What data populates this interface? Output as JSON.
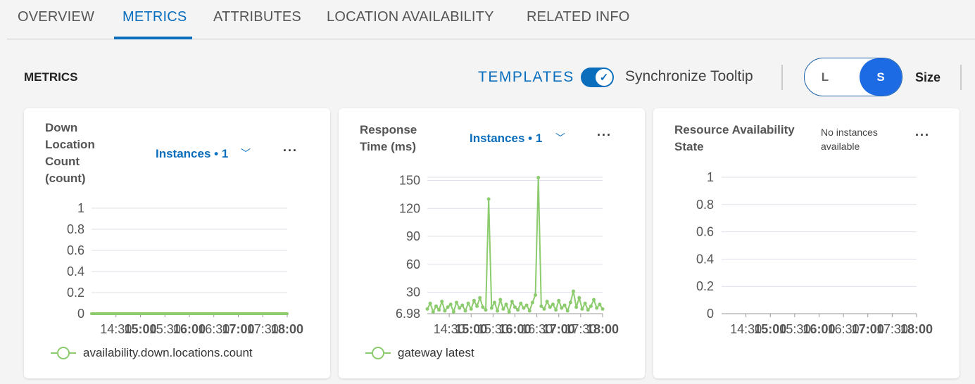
{
  "tabs": [
    {
      "label": "OVERVIEW"
    },
    {
      "label": "METRICS"
    },
    {
      "label": "ATTRIBUTES"
    },
    {
      "label": "LOCATION AVAILABILITY"
    },
    {
      "label": "RELATED INFO"
    }
  ],
  "active_tab": "METRICS",
  "toolbar": {
    "section_title": "METRICS",
    "templates": "TEMPLATES",
    "sync_tooltip": "Synchronize Tooltip",
    "sync_enabled": true,
    "size_options": [
      "L",
      "S"
    ],
    "size_selected": "S",
    "size_label": "Size"
  },
  "colors": {
    "accent": "#0a6ebd",
    "series": "#8ccb6e",
    "size_selected": "#1d6ae5"
  },
  "cards": [
    {
      "title": "Down Location Count (count)",
      "instances": "Instances • 1",
      "legend": "availability.down.locations.count"
    },
    {
      "title": "Response Time (ms)",
      "instances": "Instances • 1",
      "legend": "gateway latest"
    },
    {
      "title": "Resource Availability State",
      "status": "No instances available"
    }
  ],
  "chart_data": [
    {
      "type": "line",
      "ylim": [
        0,
        1
      ],
      "yticks": [
        "0",
        "0.2",
        "0.4",
        "0.6",
        "0.8",
        "1"
      ],
      "yvals": [
        0,
        0.2,
        0.4,
        0.6,
        0.8,
        1
      ],
      "xlim": [
        "14:00",
        "18:00"
      ],
      "xticks": [
        "14:30",
        "15:00",
        "15:30",
        "16:00",
        "16:30",
        "17:00",
        "17:30",
        "18:00"
      ],
      "series": [
        {
          "name": "availability.down.locations.count",
          "x": [
            "14:00",
            "18:00"
          ],
          "values": [
            0,
            0
          ]
        }
      ]
    },
    {
      "type": "line",
      "ylim": [
        6.98,
        153.4
      ],
      "yticks": [
        "6.98",
        "30",
        "60",
        "90",
        "120",
        "150"
      ],
      "yvals": [
        6.98,
        30,
        60,
        90,
        120,
        150
      ],
      "xlim": [
        "14:00",
        "18:00"
      ],
      "xticks": [
        "14:30",
        "15:00",
        "15:30",
        "16:00",
        "16:30",
        "17:00",
        "17:30",
        "18:00"
      ],
      "series": [
        {
          "name": "gateway latest",
          "x": [
            "14:00",
            "14:04",
            "14:08",
            "14:12",
            "14:16",
            "14:20",
            "14:24",
            "14:28",
            "14:32",
            "14:36",
            "14:40",
            "14:44",
            "14:48",
            "14:52",
            "14:56",
            "15:00",
            "15:04",
            "15:08",
            "15:12",
            "15:16",
            "15:20",
            "15:24",
            "15:28",
            "15:32",
            "15:36",
            "15:40",
            "15:44",
            "15:48",
            "15:52",
            "15:56",
            "16:00",
            "16:04",
            "16:08",
            "16:12",
            "16:16",
            "16:20",
            "16:24",
            "16:28",
            "16:32",
            "16:36",
            "16:40",
            "16:44",
            "16:48",
            "16:52",
            "16:56",
            "17:00",
            "17:04",
            "17:08",
            "17:12",
            "17:16",
            "17:20",
            "17:24",
            "17:28",
            "17:32",
            "17:36",
            "17:40",
            "17:44",
            "17:48",
            "17:52",
            "17:56",
            "18:00"
          ],
          "values": [
            12,
            18,
            9,
            15,
            11,
            20,
            10,
            14,
            17,
            9,
            19,
            13,
            16,
            10,
            18,
            12,
            21,
            15,
            24,
            14,
            11,
            130,
            13,
            19,
            10,
            22,
            12,
            17,
            9,
            20,
            14,
            11,
            18,
            13,
            16,
            10,
            19,
            27,
            153,
            15,
            12,
            20,
            14,
            17,
            11,
            21,
            13,
            16,
            10,
            19,
            31,
            14,
            24,
            12,
            18,
            11,
            15,
            22,
            13,
            17,
            12
          ]
        }
      ]
    },
    {
      "type": "line",
      "ylim": [
        0,
        1
      ],
      "yticks": [
        "0",
        "0.2",
        "0.4",
        "0.6",
        "0.8",
        "1"
      ],
      "yvals": [
        0,
        0.2,
        0.4,
        0.6,
        0.8,
        1
      ],
      "xlim": [
        "14:00",
        "18:00"
      ],
      "xticks": [
        "14:30",
        "15:00",
        "15:30",
        "16:00",
        "16:30",
        "17:00",
        "17:30",
        "18:00"
      ],
      "series": []
    }
  ]
}
